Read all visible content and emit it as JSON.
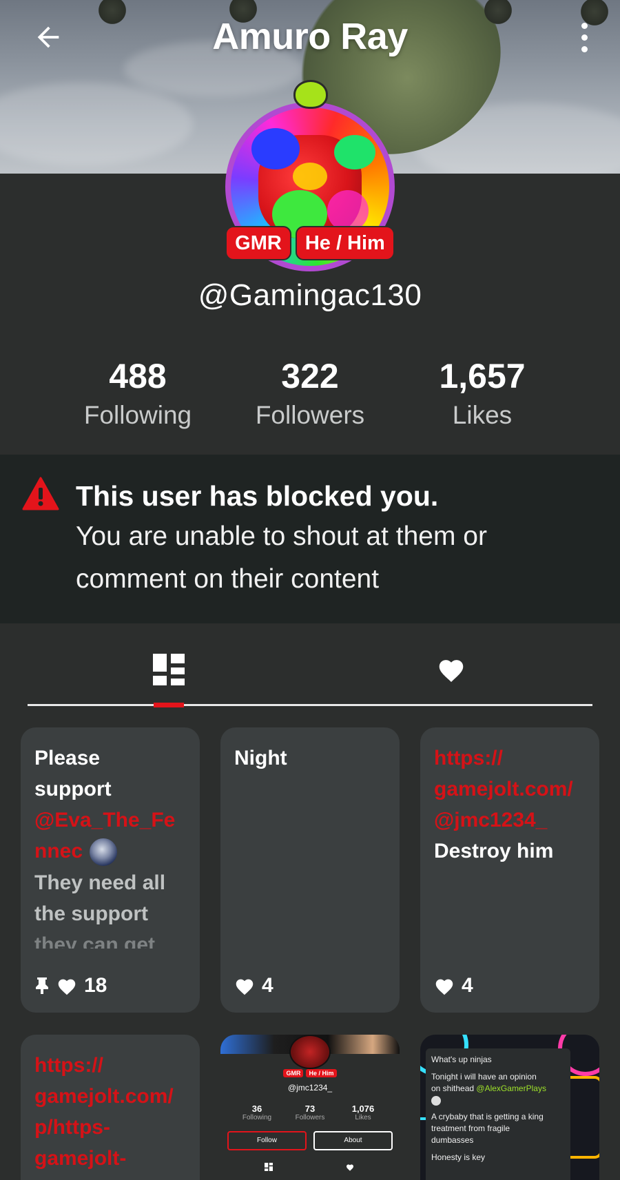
{
  "header": {
    "title": "Amuro Ray",
    "back_icon": "arrow-left-icon",
    "menu_icon": "more-vertical-icon"
  },
  "profile": {
    "badges": [
      "GMR",
      "He / Him"
    ],
    "username": "@Gamingac130",
    "stats": [
      {
        "value": "488",
        "label": "Following"
      },
      {
        "value": "322",
        "label": "Followers"
      },
      {
        "value": "1,657",
        "label": "Likes"
      }
    ]
  },
  "blocked": {
    "icon": "warning-triangle-icon",
    "heading": "This user has blocked you.",
    "message": "You are unable to shout at them or comment on their content"
  },
  "tabs": [
    {
      "name": "posts",
      "icon": "dashboard-grid-icon",
      "active": true
    },
    {
      "name": "likes",
      "icon": "heart-icon",
      "active": false
    }
  ],
  "posts": [
    {
      "line1": "Please",
      "line2": "support",
      "mention1": "@Eva_The_Fe",
      "mention2": "nnec",
      "body1": "They need all",
      "body2": "the support",
      "body3": "they can get",
      "pinned": true,
      "likes": "18"
    },
    {
      "line1": "Night",
      "likes": "4"
    },
    {
      "link1": "https://",
      "link2": "gamejolt.com/",
      "link3": "@jmc1234_",
      "line1": "Destroy him",
      "likes": "4"
    },
    {
      "link1": "https://",
      "link2": "gamejolt.com/",
      "link3": "p/https-",
      "link4": "gamejolt-"
    },
    {
      "mini_badges": [
        "GMR",
        "He / Him"
      ],
      "mini_username": "@jmc1234_",
      "mini_stats": [
        {
          "value": "36",
          "label": "Following"
        },
        {
          "value": "73",
          "label": "Followers"
        },
        {
          "value": "1,076",
          "label": "Likes"
        }
      ],
      "follow_label": "Follow",
      "about_label": "About"
    },
    {
      "line1": "What's up ninjas",
      "line2": "Tonight i will have an opinion",
      "line3": "on shithead",
      "mention": "@AlexGamerPlays",
      "line4": "A crybaby that is getting a king",
      "line5": "treatment from fragile",
      "line6": "dumbasses",
      "line7": "Honesty is key"
    }
  ]
}
